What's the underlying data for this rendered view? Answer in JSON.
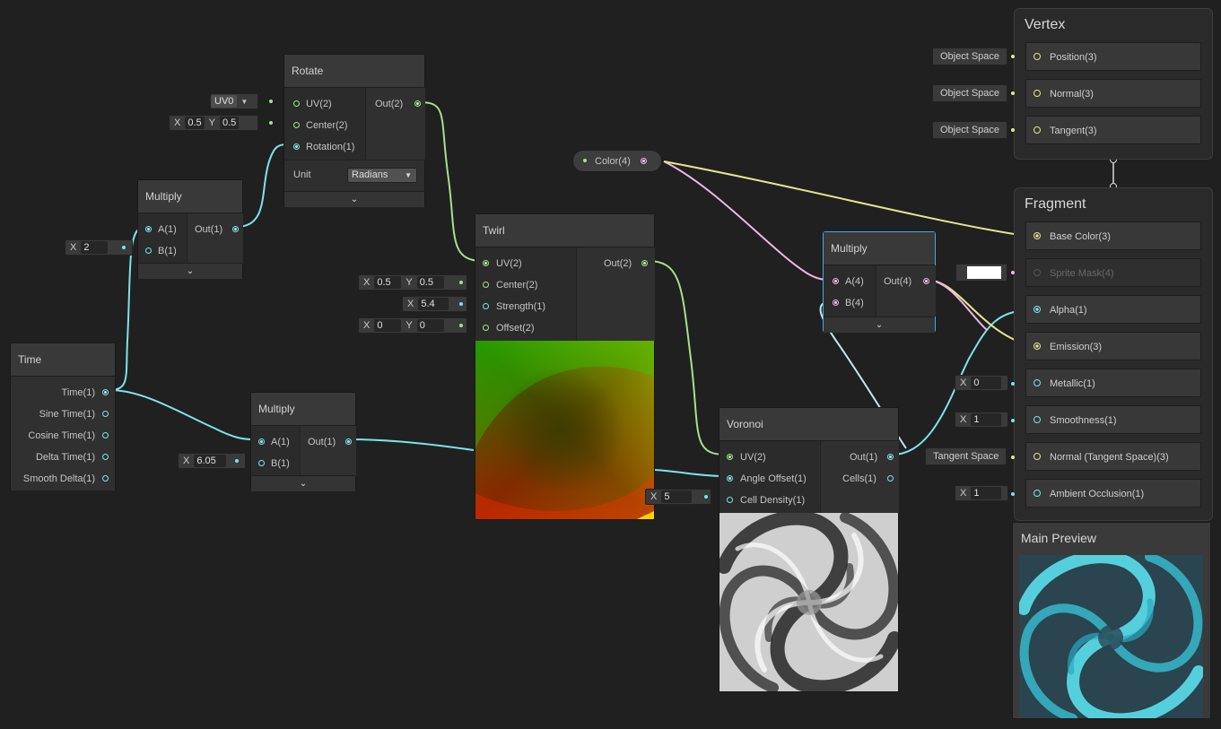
{
  "nodes": {
    "rotate": {
      "title": "Rotate",
      "in": [
        "UV(2)",
        "Center(2)",
        "Rotation(1)"
      ],
      "out": "Out(2)",
      "unit_label": "Unit",
      "unit_value": "Radians",
      "uv_value": "UV0",
      "center_x": "0.5",
      "center_y": "0.5"
    },
    "multiply1": {
      "title": "Multiply",
      "in": [
        "A(1)",
        "B(1)"
      ],
      "out": "Out(1)",
      "b_value": "2"
    },
    "time": {
      "title": "Time",
      "outputs": [
        "Time(1)",
        "Sine Time(1)",
        "Cosine Time(1)",
        "Delta Time(1)",
        "Smooth Delta(1)"
      ]
    },
    "multiply2": {
      "title": "Multiply",
      "in": [
        "A(1)",
        "B(1)"
      ],
      "out": "Out(1)",
      "b_value": "6.05"
    },
    "twirl": {
      "title": "Twirl",
      "in": [
        "UV(2)",
        "Center(2)",
        "Strength(1)",
        "Offset(2)"
      ],
      "out": "Out(2)",
      "center_x": "0.5",
      "center_y": "0.5",
      "strength": "5.4",
      "offset_x": "0",
      "offset_y": "0"
    },
    "color": {
      "label": "Color(4)"
    },
    "multiply3": {
      "title": "Multiply",
      "in": [
        "A(4)",
        "B(4)"
      ],
      "out": "Out(4)"
    },
    "voronoi": {
      "title": "Voronoi",
      "in": [
        "UV(2)",
        "Angle Offset(1)",
        "Cell Density(1)"
      ],
      "out": [
        "Out(1)",
        "Cells(1)"
      ],
      "density": "5"
    }
  },
  "vertex": {
    "title": "Vertex",
    "blocks": [
      "Position(3)",
      "Normal(3)",
      "Tangent(3)"
    ],
    "contexts": [
      "Object Space",
      "Object Space",
      "Object Space"
    ]
  },
  "fragment": {
    "title": "Fragment",
    "blocks": [
      "Base Color(3)",
      "Sprite Mask(4)",
      "Alpha(1)",
      "Emission(3)",
      "Metallic(1)",
      "Smoothness(1)",
      "Normal (Tangent Space)(3)",
      "Ambient Occlusion(1)"
    ],
    "metallic": "0",
    "smoothness": "1",
    "normal_space": "Tangent Space",
    "ao": "1"
  },
  "preview": {
    "title": "Main Preview"
  },
  "labels": {
    "x": "X",
    "y": "Y"
  },
  "colors": {
    "green": "#9fe58f",
    "cyan": "#7de3ea",
    "pink": "#f0b6e6",
    "yellow": "#e5e58f"
  }
}
